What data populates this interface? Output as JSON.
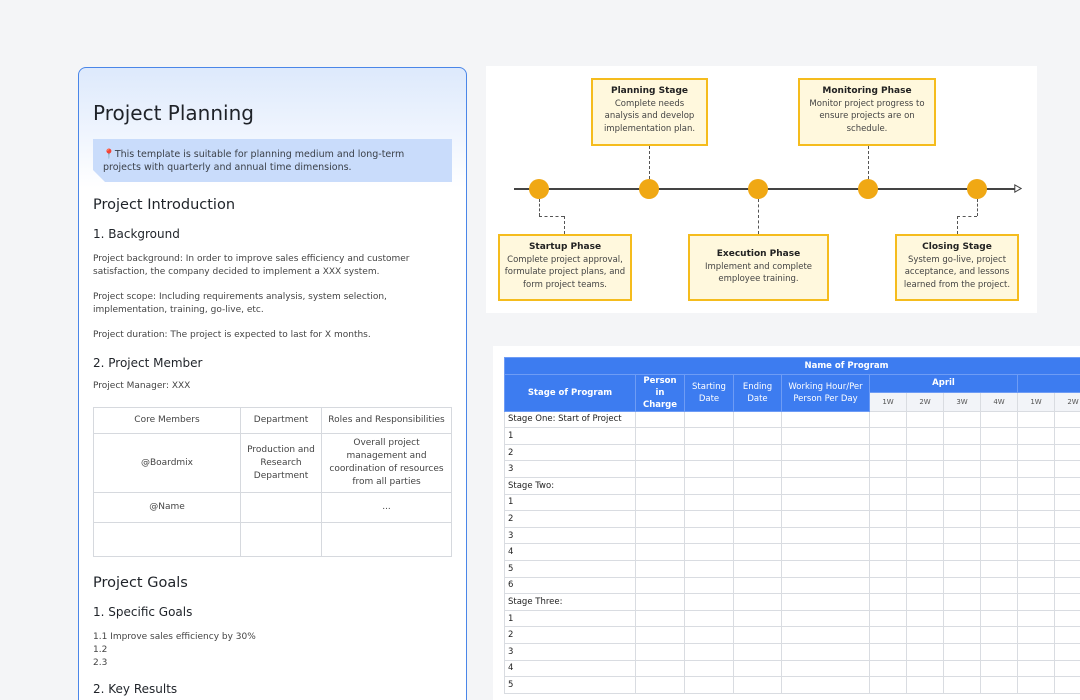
{
  "doc": {
    "title": "Project Planning",
    "callout": "This template is suitable for planning medium and long-term projects with quarterly and annual time dimensions.",
    "intro_heading": "Project Introduction",
    "background_heading": "1. Background",
    "background_text": "Project background: In order to improve sales efficiency and customer satisfaction, the company decided to implement a XXX system.",
    "scope_text": "Project scope: Including requirements analysis, system selection, implementation, training, go-live, etc.",
    "duration_text": "Project duration: The project is expected to last for X months.",
    "member_heading": "2. Project Member",
    "manager_text": "Project Manager: XXX",
    "members_table": {
      "headers": [
        "Core Members",
        "Department",
        "Roles and Responsibilities"
      ],
      "rows": [
        [
          "@Boardmix",
          "Production and Research Department",
          "Overall project management and coordination of resources from all parties"
        ],
        [
          "@Name",
          "",
          "..."
        ],
        [
          "",
          "",
          ""
        ]
      ]
    },
    "goals_heading": "Project Goals",
    "specific_goals_heading": "1. Specific Goals",
    "goals": [
      "1.1 Improve sales efficiency by 30%",
      "1.2",
      "2.3"
    ],
    "key_results_heading": "2. Key Results"
  },
  "timeline": {
    "phases": [
      {
        "title": "Startup Phase",
        "desc": "Complete project approval, formulate project plans, and form project teams."
      },
      {
        "title": "Planning Stage",
        "desc": "Complete needs analysis and develop implementation plan."
      },
      {
        "title": "Execution Phase",
        "desc": "Implement and complete employee training."
      },
      {
        "title": "Monitoring Phase",
        "desc": "Monitor project progress to ensure projects are on schedule."
      },
      {
        "title": "Closing Stage",
        "desc": "System go-live, project acceptance, and lessons learned from the project."
      }
    ],
    "colors": {
      "dot": "#f0a814",
      "box_border": "#f5bc1d",
      "box_fill": "#fff8dd"
    }
  },
  "gantt": {
    "title": "Name of Program",
    "columns": [
      "Stage of Program",
      "Person in Charge",
      "Starting Date",
      "Ending Date",
      "Working Hour/Per Person Per Day"
    ],
    "month": "April",
    "weeks": [
      "1W",
      "2W",
      "3W",
      "4W",
      "1W",
      "2W"
    ],
    "sections": [
      {
        "name": "Stage One: Start of Project",
        "rows": [
          "1",
          "2",
          "3"
        ]
      },
      {
        "name": "Stage Two:",
        "rows": [
          "1",
          "2",
          "3",
          "4",
          "5",
          "6"
        ]
      },
      {
        "name": "Stage Three:",
        "rows": [
          "1",
          "2",
          "3",
          "4",
          "5"
        ]
      }
    ],
    "header_color": "#3d7cf0"
  }
}
